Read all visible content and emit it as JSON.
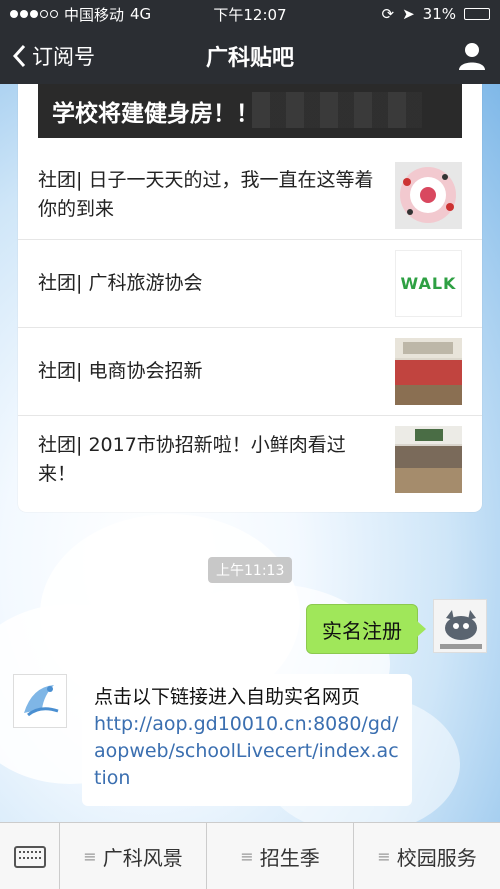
{
  "status_bar": {
    "carrier": "中国移动",
    "network": "4G",
    "time": "下午12:07",
    "battery_percent": "31%",
    "battery_level": 0.31
  },
  "nav": {
    "back_label": "订阅号",
    "title": "广科贴吧"
  },
  "card": {
    "banner_title": "学校将建健身房！！",
    "articles": [
      {
        "title": "社团| 日子一天天的过，我一直在这等着你的到来",
        "thumb_icon": "club-photo-icon"
      },
      {
        "title": "社团| 广科旅游协会",
        "thumb_icon": "walk-logo-icon",
        "thumb_text": "WALK"
      },
      {
        "title": "社团| 电商协会招新",
        "thumb_icon": "classroom-photo-icon"
      },
      {
        "title": "社团| 2017市协招新啦！小鲜肉看过来！",
        "thumb_icon": "classroom-photo-icon"
      }
    ]
  },
  "chat": {
    "timestamp": "上午11:13",
    "my_message": "实名注册",
    "bot_message": "点击以下链接进入自助实名网页",
    "bot_link": "http://aop.gd10010.cn:8080/gd/aopweb/schoolLivecert/index.action"
  },
  "bottom_menu": {
    "items": [
      "广科风景",
      "招生季",
      "校园服务"
    ]
  },
  "colors": {
    "bar_bg": "#2b2e33",
    "bubble_green": "#a0e75a",
    "link_blue": "#3b6fb0"
  }
}
